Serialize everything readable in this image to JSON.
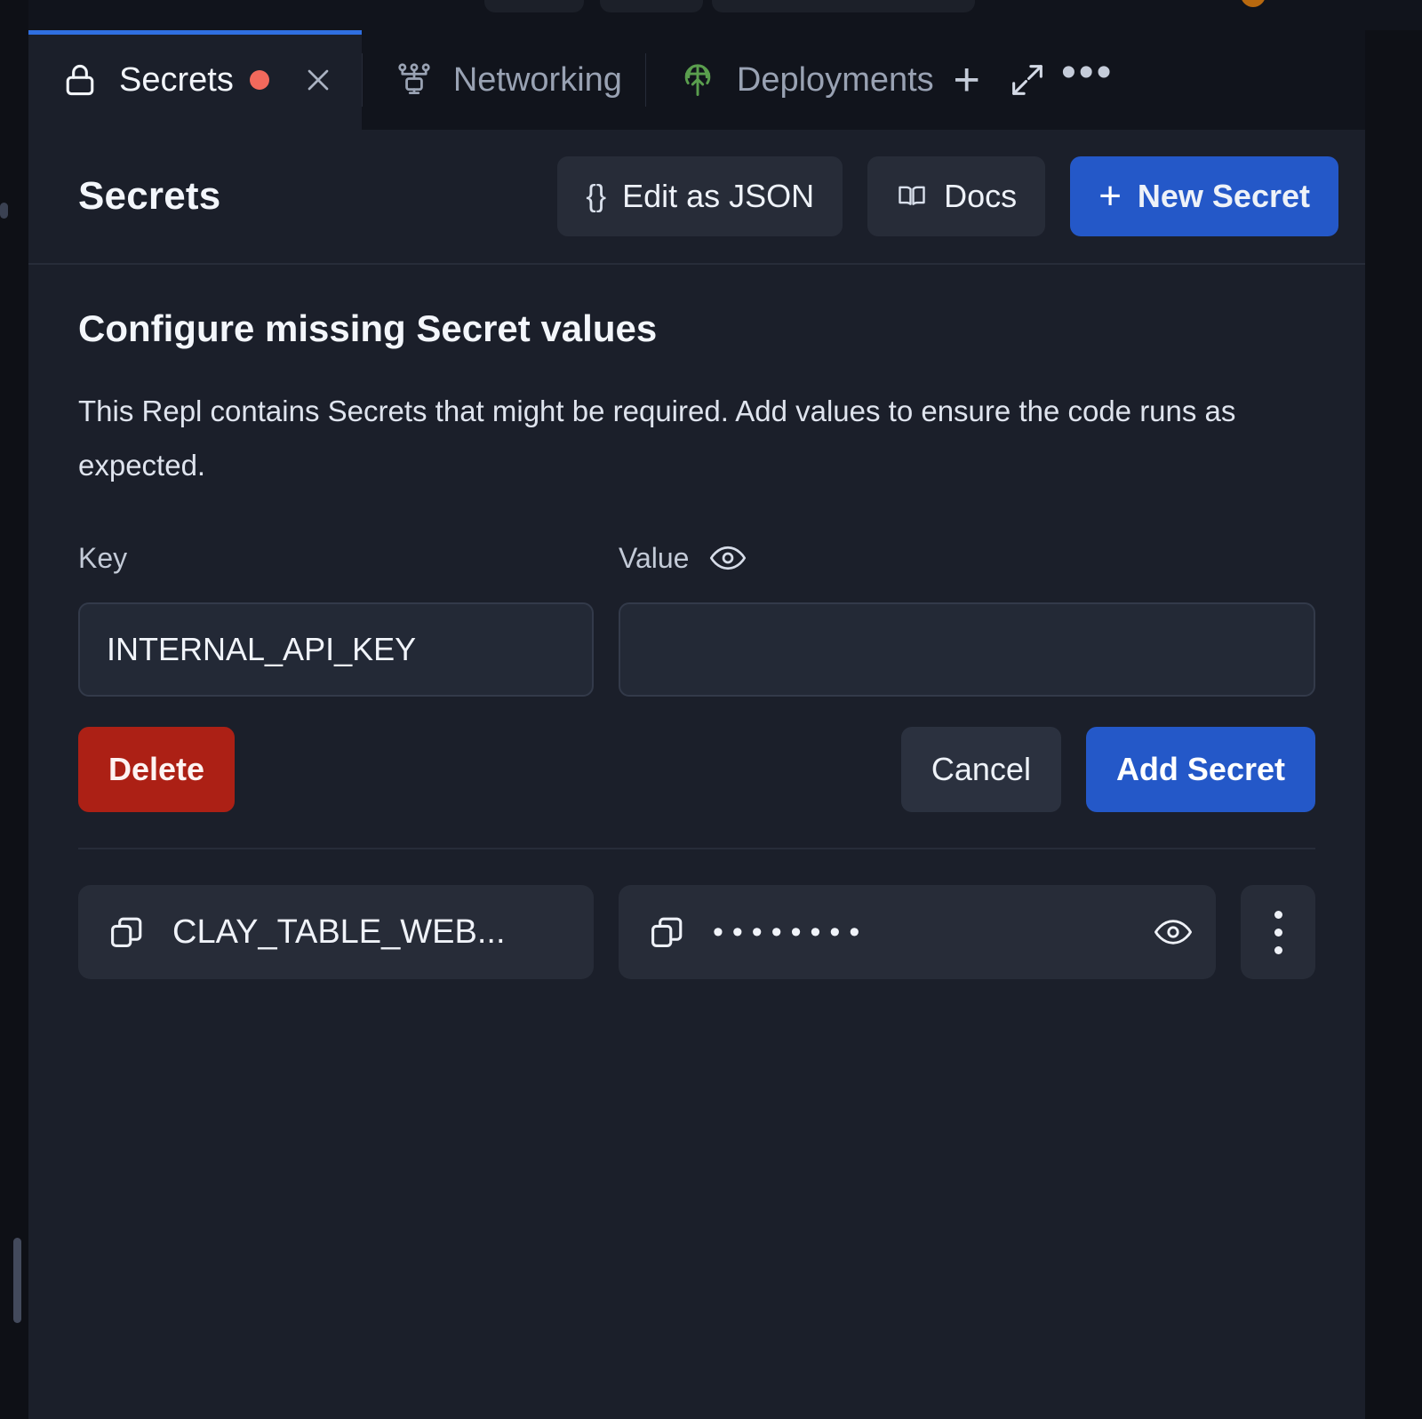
{
  "window": {
    "tabs": [
      {
        "label": "Secrets",
        "icon": "lock-icon",
        "active": true,
        "dirty": true,
        "closable": true
      },
      {
        "label": "Networking",
        "icon": "network-icon",
        "active": false,
        "dirty": false,
        "closable": false
      },
      {
        "label": "Deployments",
        "icon": "deployment-globe-icon",
        "active": false,
        "dirty": false,
        "closable": false
      }
    ],
    "actions": {
      "new_tab": "+",
      "expand": "expand-icon",
      "more": "•••"
    }
  },
  "header": {
    "title": "Secrets",
    "edit_json_label": "Edit as JSON",
    "edit_json_glyph": "{}",
    "docs_label": "Docs",
    "docs_icon": "book-icon",
    "new_secret_label": "New Secret",
    "new_secret_glyph": "+"
  },
  "main": {
    "section_title": "Configure missing Secret values",
    "section_description": "This Repl contains Secrets that might be required. Add values to ensure the code runs as expected.",
    "labels": {
      "key": "Key",
      "value": "Value"
    },
    "form": {
      "key_value": "INTERNAL_API_KEY",
      "value_value": "",
      "value_placeholder": ""
    },
    "buttons": {
      "delete": "Delete",
      "cancel": "Cancel",
      "add_secret": "Add Secret"
    }
  },
  "secrets_list": [
    {
      "key": "CLAY_TABLE_WEB...",
      "masked_value": "••••••••",
      "masked_dots": 8
    }
  ],
  "colors": {
    "app_background": "#0e1016",
    "panel_background": "#1b1f2a",
    "tabbar_background": "#11141c",
    "accent_blue": "#2458c8",
    "active_tab_indicator": "#2f6fe0",
    "danger_red": "#ac2015",
    "dirty_dot": "#f2695c",
    "deployment_green": "#5a9e4e",
    "avatar_orange": "#b8690f",
    "input_background": "#232936",
    "chip_background": "#272c38",
    "divider": "#272c39",
    "text_primary": "#f3f6fb",
    "text_secondary": "#c3cad7"
  }
}
